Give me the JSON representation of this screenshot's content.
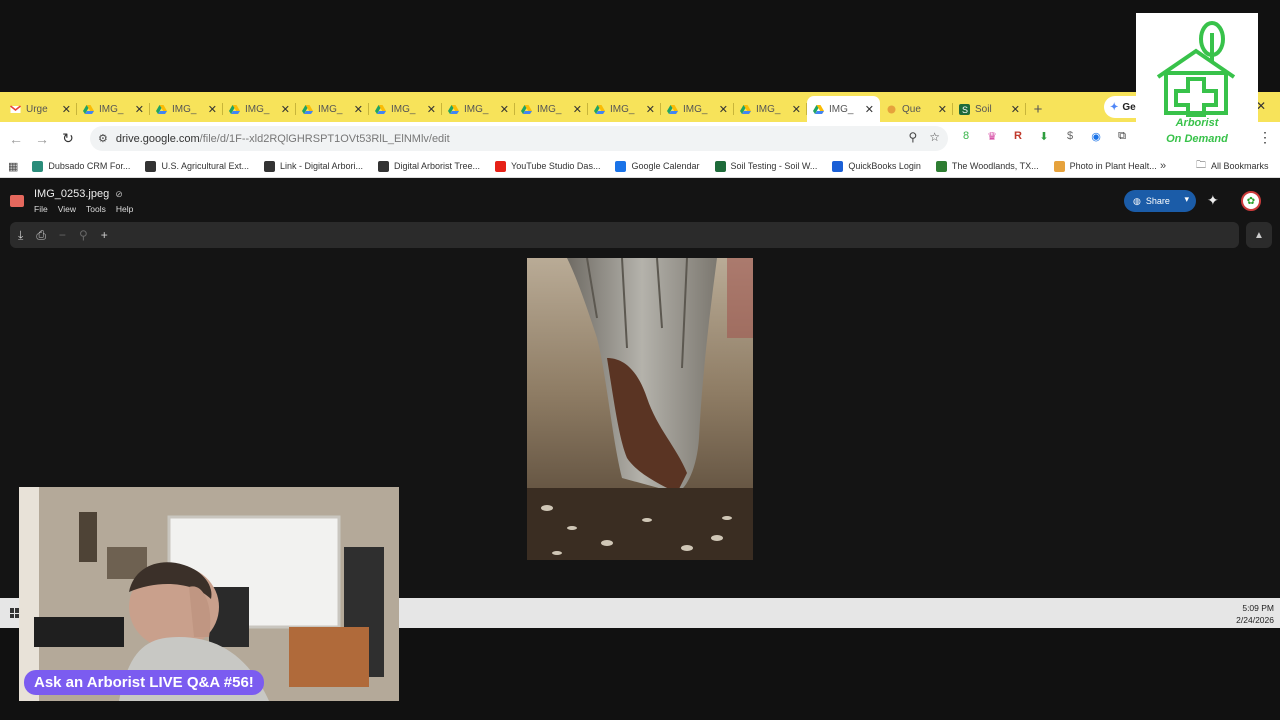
{
  "tabs": [
    {
      "title": "Urge",
      "icon": "gmail-icon",
      "active": false
    },
    {
      "title": "IMG_",
      "icon": "drive-icon",
      "active": false
    },
    {
      "title": "IMG_",
      "icon": "drive-icon",
      "active": false
    },
    {
      "title": "IMG_",
      "icon": "drive-icon",
      "active": false
    },
    {
      "title": "IMG_",
      "icon": "drive-icon",
      "active": false
    },
    {
      "title": "IMG_",
      "icon": "drive-icon",
      "active": false
    },
    {
      "title": "IMG_",
      "icon": "drive-icon",
      "active": false
    },
    {
      "title": "IMG_",
      "icon": "drive-icon",
      "active": false
    },
    {
      "title": "IMG_",
      "icon": "drive-icon",
      "active": false
    },
    {
      "title": "IMG_",
      "icon": "drive-icon",
      "active": false
    },
    {
      "title": "IMG_",
      "icon": "drive-icon",
      "active": false
    },
    {
      "title": "IMG_",
      "icon": "drive-icon",
      "active": true
    },
    {
      "title": "Que",
      "icon": "forms-icon",
      "active": false
    },
    {
      "title": "Soil",
      "icon": "soil-s-icon",
      "active": false
    }
  ],
  "gemini_tab": "Ge",
  "address": {
    "url_main": "drive.google.com",
    "url_path": "/file/d/1F--xld2RQlGHRSPT1OVt53RlL_ElNMlv/edit"
  },
  "bookmarks": [
    {
      "label": "Dubsado CRM For...",
      "color": "#2a8c7a"
    },
    {
      "label": "U.S. Agricultural Ext...",
      "color": "#333333"
    },
    {
      "label": "Link - Digital Arbori...",
      "color": "#333333"
    },
    {
      "label": "Digital Arborist Tree...",
      "color": "#333333"
    },
    {
      "label": "YouTube Studio Das...",
      "color": "#e62117"
    },
    {
      "label": "Google Calendar",
      "color": "#1a73e8"
    },
    {
      "label": "Soil Testing - Soil W...",
      "color": "#1e6b3a"
    },
    {
      "label": "QuickBooks Login",
      "color": "#1a5fd6"
    },
    {
      "label": "The Woodlands, TX...",
      "color": "#2e7d32"
    },
    {
      "label": "Photo in Plant Healt...",
      "color": "#e6a23c"
    }
  ],
  "all_bookmarks": "All Bookmarks",
  "viewer": {
    "file_name": "IMG_0253.jpeg",
    "menu": [
      "File",
      "View",
      "Tools",
      "Help"
    ],
    "share_label": "Share"
  },
  "taskbar": {
    "time": "5:09 PM",
    "date": "2/24/2026"
  },
  "logo": {
    "line1": "Arborist",
    "line2": "On Demand",
    "color": "#38c24a"
  },
  "banner": "Ask an Arborist LIVE Q&A #56!"
}
